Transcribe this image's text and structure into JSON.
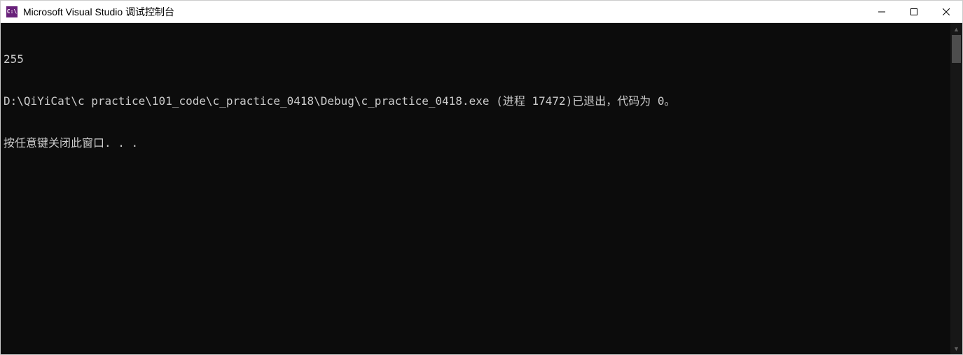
{
  "titlebar": {
    "icon_text": "C:\\",
    "title": "Microsoft Visual Studio 调试控制台"
  },
  "console": {
    "lines": [
      "255",
      "D:\\QiYiCat\\c practice\\101_code\\c_practice_0418\\Debug\\c_practice_0418.exe (进程 17472)已退出，代码为 0。",
      "按任意键关闭此窗口. . ."
    ]
  }
}
